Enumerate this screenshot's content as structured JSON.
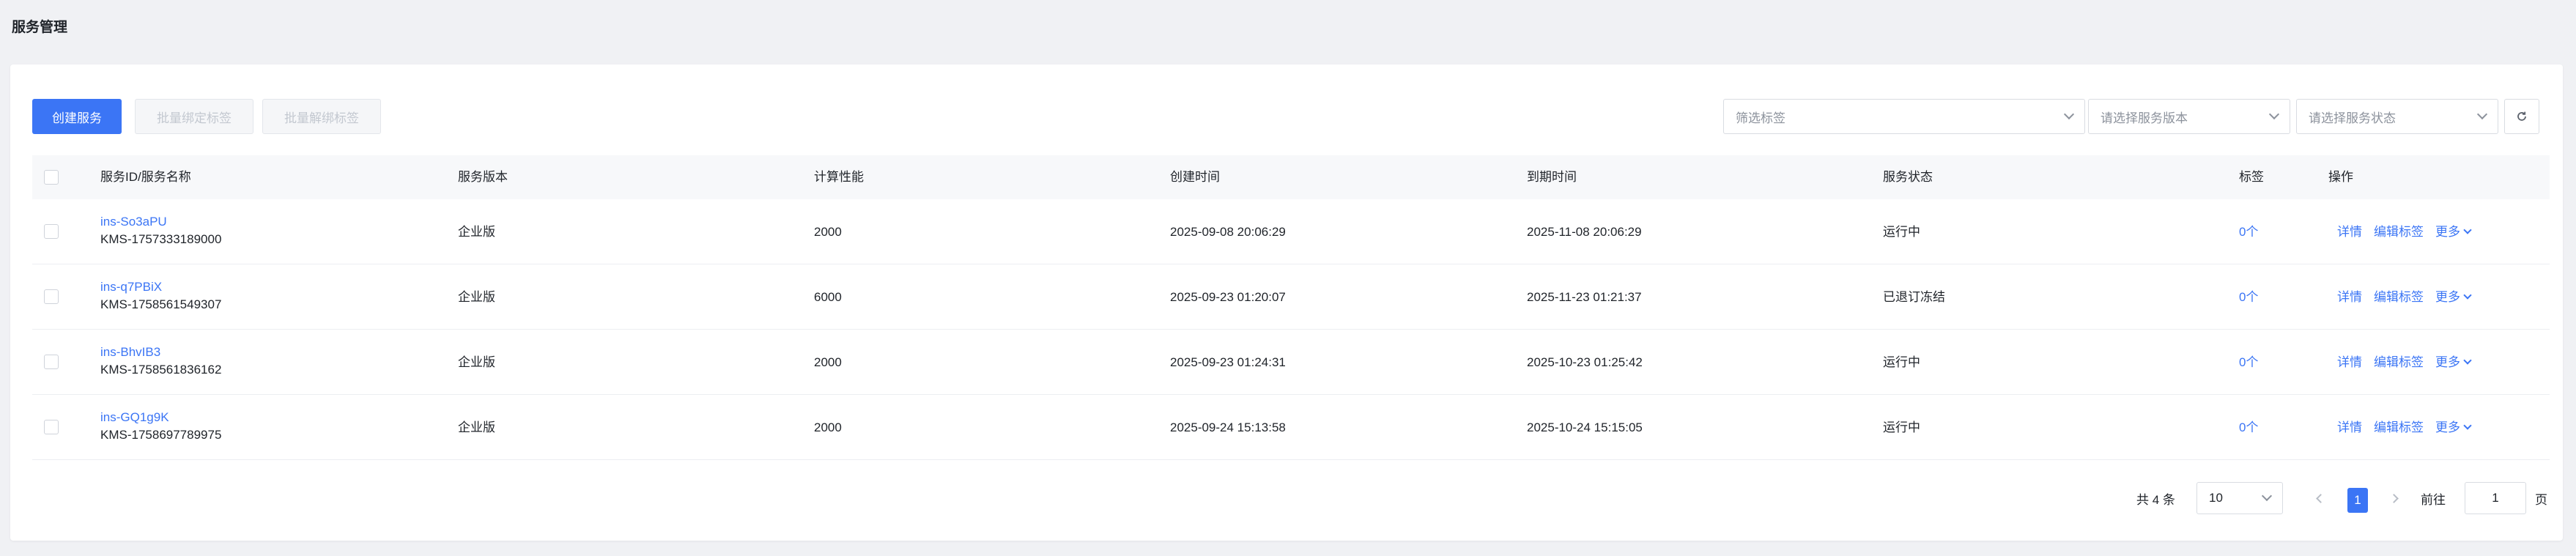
{
  "page": {
    "title": "服务管理"
  },
  "toolbar": {
    "create_label": "创建服务",
    "bind_tags_label": "批量绑定标签",
    "unbind_tags_label": "批量解绑标签",
    "filter_tags_placeholder": "筛选标签",
    "version_placeholder": "请选择服务版本",
    "status_placeholder": "请选择服务状态"
  },
  "table": {
    "columns": {
      "id_name": "服务ID/服务名称",
      "version": "服务版本",
      "performance": "计算性能",
      "created": "创建时间",
      "expires": "到期时间",
      "status": "服务状态",
      "tags": "标签",
      "actions": "操作"
    },
    "rows": [
      {
        "id": "ins-So3aPU",
        "name": "KMS-1757333189000",
        "version": "企业版",
        "performance": "2000",
        "created": "2025-09-08 20:06:29",
        "expires": "2025-11-08 20:06:29",
        "status": "运行中",
        "tags": "0个"
      },
      {
        "id": "ins-q7PBiX",
        "name": "KMS-1758561549307",
        "version": "企业版",
        "performance": "6000",
        "created": "2025-09-23 01:20:07",
        "expires": "2025-11-23 01:21:37",
        "status": "已退订冻结",
        "tags": "0个"
      },
      {
        "id": "ins-BhvIB3",
        "name": "KMS-1758561836162",
        "version": "企业版",
        "performance": "2000",
        "created": "2025-09-23 01:24:31",
        "expires": "2025-10-23 01:25:42",
        "status": "运行中",
        "tags": "0个"
      },
      {
        "id": "ins-GQ1g9K",
        "name": "KMS-1758697789975",
        "version": "企业版",
        "performance": "2000",
        "created": "2025-09-24 15:13:58",
        "expires": "2025-10-24 15:15:05",
        "status": "运行中",
        "tags": "0个"
      }
    ],
    "row_actions": {
      "details": "详情",
      "edit_tags": "编辑标签",
      "more": "更多"
    }
  },
  "pagination": {
    "total": "共 4 条",
    "page_size": "10",
    "current_page": "1",
    "goto_prefix": "前往",
    "goto_value": "1",
    "goto_suffix": "页"
  },
  "colors": {
    "primary": "#3b75f5",
    "background": "#f0f1f4"
  }
}
